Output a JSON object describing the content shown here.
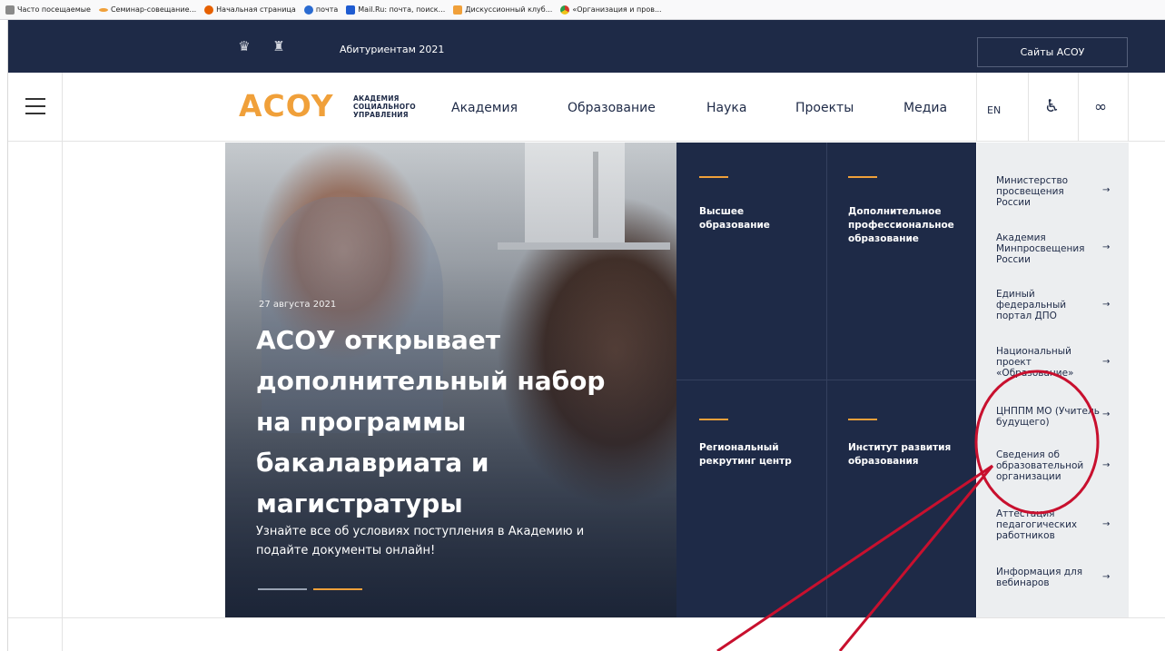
{
  "bookmarks": [
    {
      "label": "Часто посещаемые",
      "color": "#8a8a8a"
    },
    {
      "label": "Семинар-совещание...",
      "color": "#f0a03a"
    },
    {
      "label": "Начальная страница",
      "color": "#e66000"
    },
    {
      "label": "почта",
      "color": "#2a6bd1"
    },
    {
      "label": "Mail.Ru: почта, поиск...",
      "color": "#1e5bd1"
    },
    {
      "label": "Дискуссионный клуб...",
      "color": "#f0a03a"
    },
    {
      "label": "«Организация и пров...",
      "color": "#d23a2a"
    }
  ],
  "topbar": {
    "applicants": "Абитуриентам 2021",
    "sites_button": "Сайты АСОУ"
  },
  "header": {
    "logo_mark": "ACOY",
    "logo_line1": "АКАДЕМИЯ",
    "logo_line2": "СОЦИАЛЬНОГО",
    "logo_line3": "УПРАВЛЕНИЯ",
    "nav": [
      "Академия",
      "Образование",
      "Наука",
      "Проекты",
      "Медиа"
    ],
    "lang": "EN"
  },
  "hero": {
    "date": "27 августа 2021",
    "title": "АСОУ открывает дополнительный набор на программы бакалавриата и магистратуры",
    "subtitle": "Узнайте все об условиях поступления в Академию и подайте документы онлайн!"
  },
  "tiles": [
    "Высшее образование",
    "Дополнительное профессиональное образование",
    "Региональный рекрутинг центр",
    "Институт развития образования"
  ],
  "links": [
    "Министерство просвещения России",
    "Академия Минпросвещения России",
    "Единый федеральный портал ДПО",
    "Национальный проект «Образование»",
    "ЦНППМ МО (Учитель будущего)",
    "Сведения об образовательной организации",
    "Аттестация педагогических работников",
    "Информация для вебинаров"
  ],
  "arrow": "→",
  "colors": {
    "navy": "#1e2a47",
    "accent": "#f0a03a",
    "annotation": "#c8102e"
  }
}
